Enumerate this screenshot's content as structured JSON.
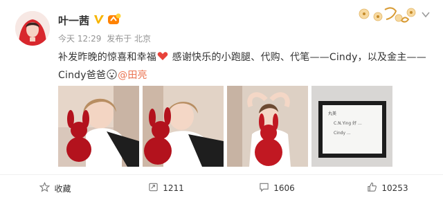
{
  "post": {
    "author": "叶一茜",
    "time": "今天 12:29",
    "source": "发布于 北京",
    "text_main": "补发昨晚的惊喜和幸福",
    "text_rest": " 感谢快乐的小跑腿、代购、代笔——Cindy，以及金主——Cindy爸爸",
    "mention": "@田亮",
    "note_lines": [
      "丸美",
      "C.N.Ying 好 ...",
      "Cindy ..."
    ]
  },
  "actions": {
    "favorite": "收藏",
    "repost": "1211",
    "comment": "1606",
    "like": "10253"
  },
  "colors": {
    "link": "#eb7350",
    "meta": "#939393",
    "badge_v": "#f7b500"
  }
}
